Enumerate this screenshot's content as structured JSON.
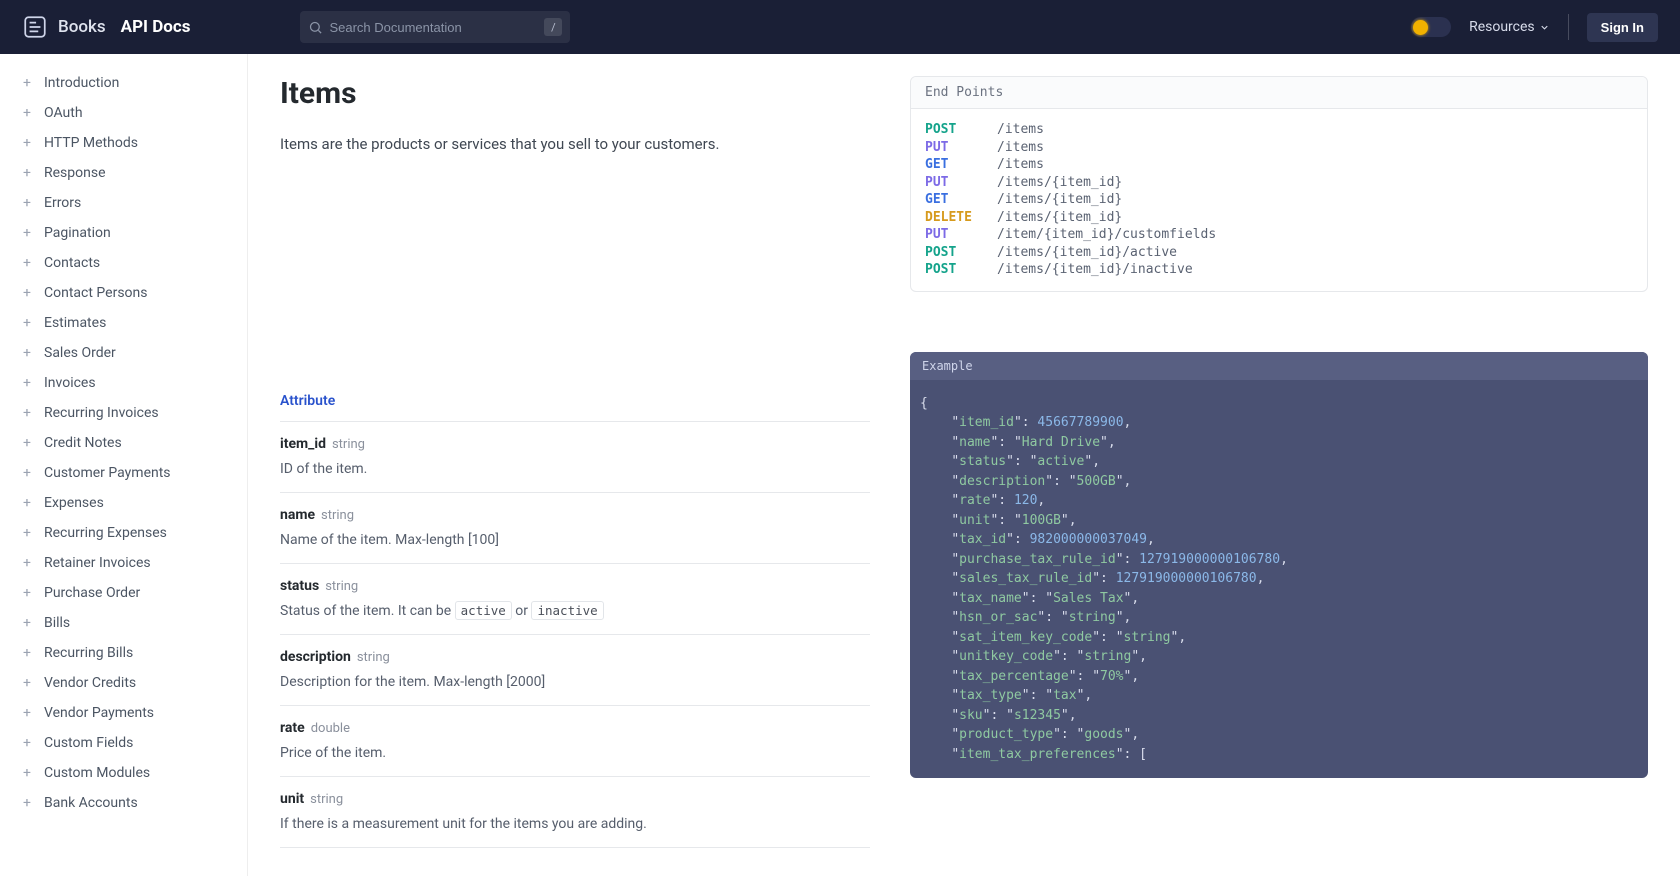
{
  "header": {
    "brand": "Books",
    "docs": "API Docs",
    "search_placeholder": "Search Documentation",
    "slash": "/",
    "resources": "Resources",
    "signin": "Sign In"
  },
  "sidebar": {
    "items": [
      "Introduction",
      "OAuth",
      "HTTP Methods",
      "Response",
      "Errors",
      "Pagination",
      "Contacts",
      "Contact Persons",
      "Estimates",
      "Sales Order",
      "Invoices",
      "Recurring Invoices",
      "Credit Notes",
      "Customer Payments",
      "Expenses",
      "Recurring Expenses",
      "Retainer Invoices",
      "Purchase Order",
      "Bills",
      "Recurring Bills",
      "Vendor Credits",
      "Vendor Payments",
      "Custom Fields",
      "Custom Modules",
      "Bank Accounts"
    ]
  },
  "page": {
    "title": "Items",
    "intro": "Items are the products or services that you sell to your customers.",
    "attr_header": "Attribute"
  },
  "attributes": [
    {
      "name": "item_id",
      "type": "string",
      "desc_pre": "ID of the item.",
      "chips": [],
      "desc_post": ""
    },
    {
      "name": "name",
      "type": "string",
      "desc_pre": "Name of the item. Max-length [100]",
      "chips": [],
      "desc_post": ""
    },
    {
      "name": "status",
      "type": "string",
      "desc_pre": "Status of the item. It can be ",
      "chips": [
        "active",
        "inactive"
      ],
      "chip_sep": " or ",
      "desc_post": ""
    },
    {
      "name": "description",
      "type": "string",
      "desc_pre": "Description for the item. Max-length [2000]",
      "chips": [],
      "desc_post": ""
    },
    {
      "name": "rate",
      "type": "double",
      "desc_pre": "Price of the item.",
      "chips": [],
      "desc_post": ""
    },
    {
      "name": "unit",
      "type": "string",
      "desc_pre": "If there is a measurement unit for the items you are adding.",
      "chips": [],
      "desc_post": ""
    }
  ],
  "endpoints_title": "End Points",
  "endpoints": [
    {
      "method": "POST",
      "path": "/items"
    },
    {
      "method": "PUT",
      "path": "/items"
    },
    {
      "method": "GET",
      "path": "/items"
    },
    {
      "method": "PUT",
      "path": "/items/{item_id}"
    },
    {
      "method": "GET",
      "path": "/items/{item_id}"
    },
    {
      "method": "DELETE",
      "path": "/items/{item_id}"
    },
    {
      "method": "PUT",
      "path": "/item/{item_id}/customfields"
    },
    {
      "method": "POST",
      "path": "/items/{item_id}/active"
    },
    {
      "method": "POST",
      "path": "/items/{item_id}/inactive"
    }
  ],
  "example_title": "Example",
  "example": [
    {
      "key": "item_id",
      "val": "45667789900",
      "t": "num"
    },
    {
      "key": "name",
      "val": "Hard Drive",
      "t": "str"
    },
    {
      "key": "status",
      "val": "active",
      "t": "str"
    },
    {
      "key": "description",
      "val": "500GB",
      "t": "str"
    },
    {
      "key": "rate",
      "val": "120",
      "t": "num"
    },
    {
      "key": "unit",
      "val": "100GB",
      "t": "str"
    },
    {
      "key": "tax_id",
      "val": "982000000037049",
      "t": "num"
    },
    {
      "key": "purchase_tax_rule_id",
      "val": "127919000000106780",
      "t": "num"
    },
    {
      "key": "sales_tax_rule_id",
      "val": "127919000000106780",
      "t": "num"
    },
    {
      "key": "tax_name",
      "val": "Sales Tax",
      "t": "str"
    },
    {
      "key": "hsn_or_sac",
      "val": "string",
      "t": "str"
    },
    {
      "key": "sat_item_key_code",
      "val": "string",
      "t": "str"
    },
    {
      "key": "unitkey_code",
      "val": "string",
      "t": "str"
    },
    {
      "key": "tax_percentage",
      "val": "70%",
      "t": "str"
    },
    {
      "key": "tax_type",
      "val": "tax",
      "t": "str"
    },
    {
      "key": "sku",
      "val": "s12345",
      "t": "str"
    },
    {
      "key": "product_type",
      "val": "goods",
      "t": "str"
    },
    {
      "key": "item_tax_preferences",
      "val": "[",
      "t": "raw"
    }
  ]
}
